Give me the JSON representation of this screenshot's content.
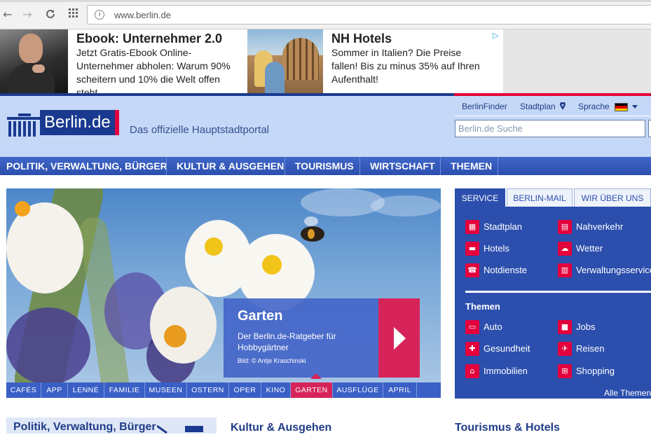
{
  "browser": {
    "url": "www.berlin.de",
    "back_icon": "←",
    "forward_icon": "→",
    "reload_icon": "C",
    "apps_icon": "grid"
  },
  "ads": [
    {
      "title": "Ebook: Unternehmer 2.0",
      "text_lines": [
        "Jetzt Gratis-Ebook Online-",
        "Unternehmer abholen: Warum 90%",
        "scheitern und 10% die Welt offen",
        "steht"
      ]
    },
    {
      "title": "NH Hotels",
      "text_lines": [
        "Sommer in Italien? Die Preise",
        "fallen! Bis zu minus 35% auf Ihren",
        "Aufenthalt!"
      ]
    }
  ],
  "header": {
    "logo_text": "Berlin.de",
    "tagline": "Das offizielle Hauptstadtportal",
    "links": [
      "BerlinFinder",
      "Stadtplan",
      "Sprache"
    ],
    "search_placeholder": "Berlin.de Suche"
  },
  "main_nav": [
    "POLITIK, VERWALTUNG, BÜRGER",
    "KULTUR & AUSGEHEN",
    "TOURISMUS",
    "WIRTSCHAFT",
    "THEMEN"
  ],
  "hero": {
    "title": "Garten",
    "description": "Der Berlin.de-Ratgeber für Hobbygärtner",
    "credit": "Bild: © Antje Kraschinski"
  },
  "tags": [
    "CAFÉS",
    "APP",
    "LENNÉ",
    "FAMILIE",
    "MUSEEN",
    "OSTERN",
    "OPER",
    "KINO",
    "GARTEN",
    "AUSFLÜGE",
    "APRIL"
  ],
  "tags_active": "GARTEN",
  "service": {
    "tabs": [
      "SERVICE",
      "BERLIN-MAIL",
      "WIR ÜBER UNS"
    ],
    "items": [
      "Stadtplan",
      "Nahverkehr",
      "Hotels",
      "Wetter",
      "Notdienste",
      "Verwaltungsservice"
    ],
    "themen_heading": "Themen",
    "themen": [
      "Auto",
      "Jobs",
      "Gesundheit",
      "Reisen",
      "Immobilien",
      "Shopping"
    ],
    "more": "Alle Themen"
  },
  "sections": [
    "Politik, Verwaltung, Bürger",
    "Kultur & Ausgehen",
    "Tourismus & Hotels"
  ],
  "colors": {
    "brand_blue": "#2c4fad",
    "brand_red": "#e4003c",
    "accent_pink": "#d6245a",
    "header_bg": "#c5d8f7"
  }
}
